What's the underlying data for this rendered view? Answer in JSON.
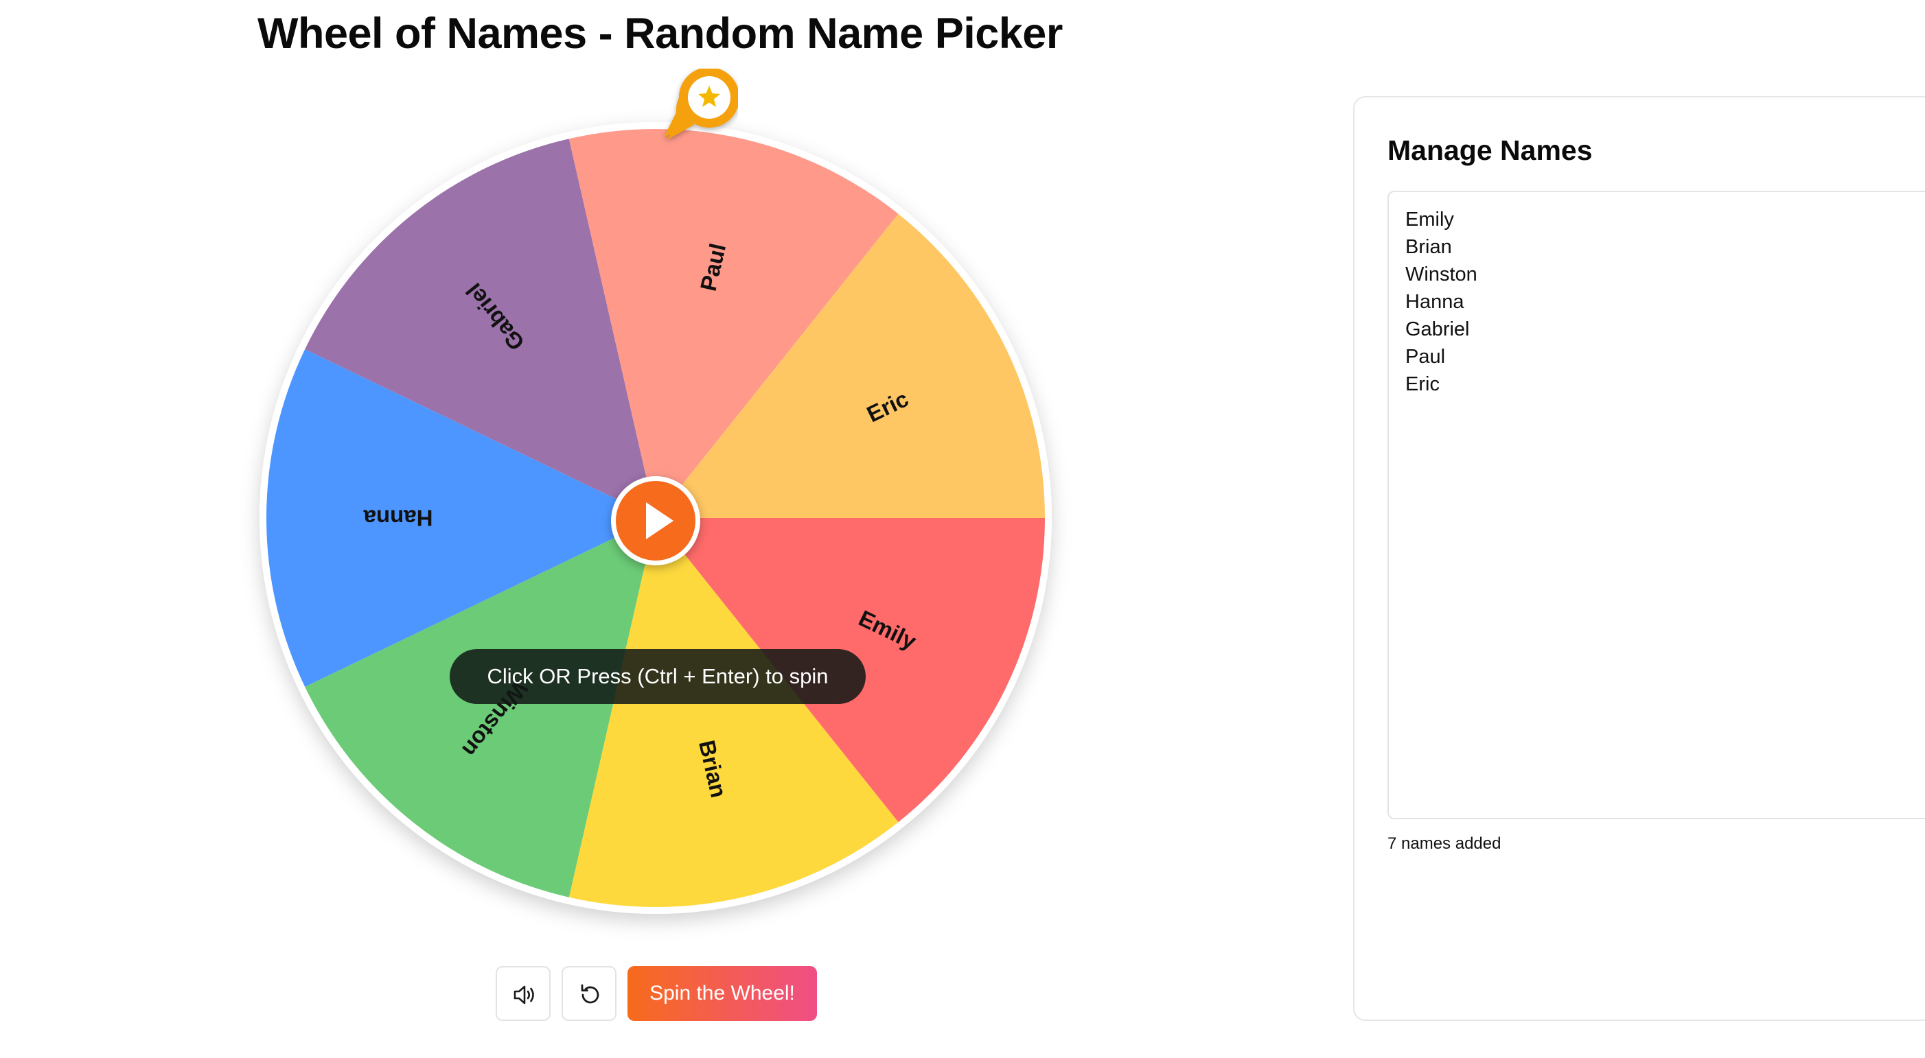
{
  "page_title": "Wheel of Names - Random Name Picker",
  "wheel": {
    "center_button_icon": "play-icon",
    "pointer_icon": "star-pin-icon",
    "tooltip": "Click OR Press (Ctrl + Enter) to spin",
    "segments": [
      {
        "name": "Emily",
        "color": "#ff6b6b"
      },
      {
        "name": "Brian",
        "color": "#fdd93d"
      },
      {
        "name": "Winston",
        "color": "#6bcb77"
      },
      {
        "name": "Hanna",
        "color": "#4d96ff"
      },
      {
        "name": "Gabriel",
        "color": "#9b72aa"
      },
      {
        "name": "Paul",
        "color": "#ff9a8b"
      },
      {
        "name": "Eric",
        "color": "#ffc764"
      }
    ]
  },
  "controls": {
    "sound_icon": "speaker-icon",
    "reset_icon": "reset-icon",
    "spin_label": "Spin the Wheel!"
  },
  "panel": {
    "title": "Manage Names",
    "names": [
      "Emily",
      "Brian",
      "Winston",
      "Hanna",
      "Gabriel",
      "Paul",
      "Eric"
    ],
    "count_text": "7 names added"
  },
  "colors": {
    "accent": "#f76b1c",
    "accent_end": "#ef4f86",
    "pointer": "#f5a00d"
  }
}
